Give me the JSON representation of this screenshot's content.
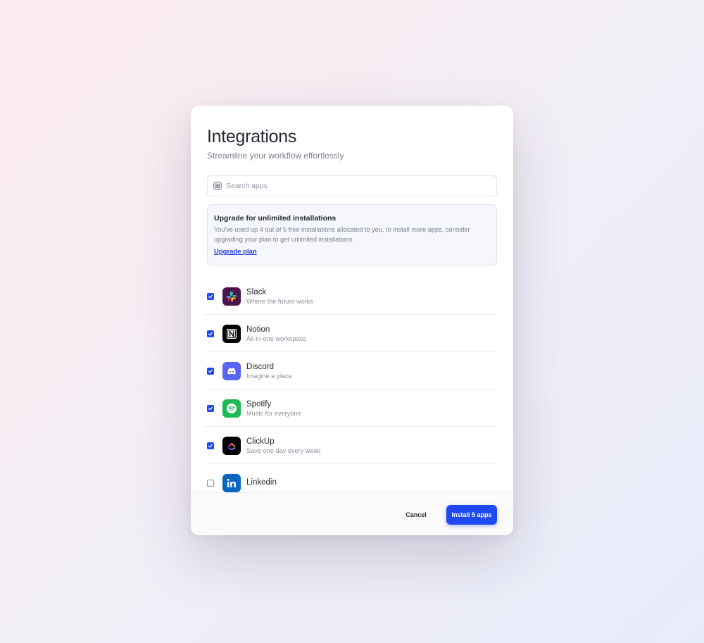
{
  "modal": {
    "title": "Integrations",
    "subtitle": "Streamline your workflow effortlessly"
  },
  "search": {
    "placeholder": "Search apps",
    "value": ""
  },
  "notice": {
    "title": "Upgrade for unlimited installations",
    "body": "You've used up 4 out of 5 free installations allocated to you, to install more apps, consider upgrading your plan to get unlimited installations",
    "link": "Upgrade plan"
  },
  "apps": [
    {
      "name": "Slack",
      "desc": "Where the future works",
      "checked": true,
      "icon": "slack-logo"
    },
    {
      "name": "Notion",
      "desc": "All-in-one workspace",
      "checked": true,
      "icon": "notion-logo"
    },
    {
      "name": "Discord",
      "desc": "Imagine a place",
      "checked": true,
      "icon": "discord-logo"
    },
    {
      "name": "Spotify",
      "desc": "Music for everyone",
      "checked": true,
      "icon": "spotify-logo"
    },
    {
      "name": "ClickUp",
      "desc": "Save one day every week",
      "checked": true,
      "icon": "clickup-logo"
    },
    {
      "name": "Linkedin",
      "desc": "",
      "checked": false,
      "icon": "linkedin-logo"
    }
  ],
  "footer": {
    "cancel_label": "Cancel",
    "install_label": "Install 5 apps"
  },
  "colors": {
    "accent": "#1f49f0",
    "link": "#2141e6"
  }
}
